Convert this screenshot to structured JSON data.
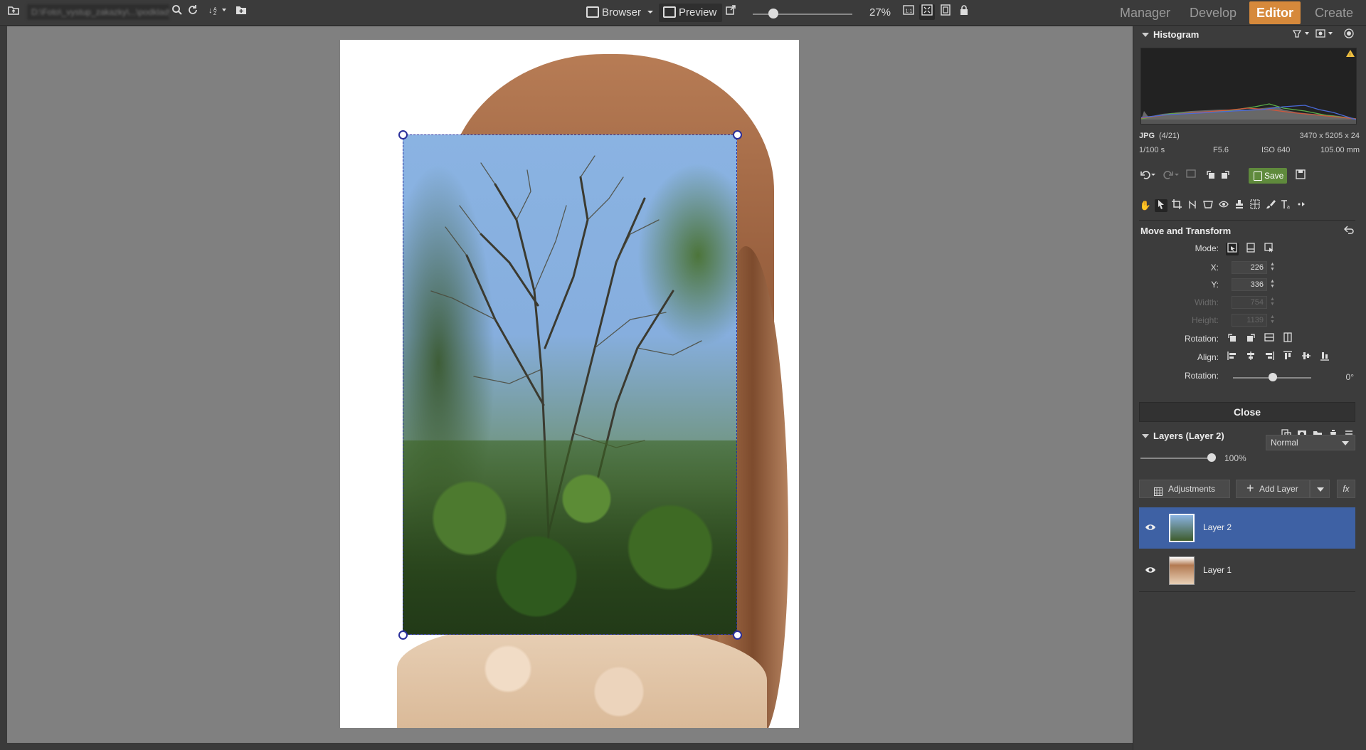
{
  "topbar": {
    "path_text": "D:\\Foto\\_vystup_zakazky\\...\\podklady",
    "browser_label": "Browser",
    "preview_label": "Preview",
    "zoom_value": "27%",
    "zoom_level": 0.27,
    "tabs": [
      {
        "label": "Manager",
        "active": false
      },
      {
        "label": "Develop",
        "active": false
      },
      {
        "label": "Editor",
        "active": true
      },
      {
        "label": "Create",
        "active": false
      }
    ],
    "accent_color": "#d6893b"
  },
  "histogram": {
    "title": "Histogram",
    "format": "JPG",
    "index": "(4/21)",
    "dimensions": "3470 x 5205 x 24",
    "shutter": "1/100 s",
    "aperture": "F5.6",
    "iso": "ISO 640",
    "focal": "105.00 mm"
  },
  "actions": {
    "save_label": "Save"
  },
  "transform": {
    "title": "Move and Transform",
    "mode_label": "Mode:",
    "x_label": "X:",
    "x_value": "226",
    "y_label": "Y:",
    "y_value": "336",
    "width_label": "Width:",
    "width_value": "754",
    "height_label": "Height:",
    "height_value": "1139",
    "rotation_label": "Rotation:",
    "align_label": "Align:",
    "rotation2_label": "Rotation:",
    "rotation_value": "0°",
    "close_label": "Close"
  },
  "layers": {
    "title": "Layers (Layer 2)",
    "opacity": "100%",
    "opacity_level": 1.0,
    "blend_mode": "Normal",
    "adjustments_label": "Adjustments",
    "add_layer_label": "Add Layer",
    "fx_label": "fx",
    "items": [
      {
        "name": "Layer 2",
        "active": true
      },
      {
        "name": "Layer 1",
        "active": false
      }
    ],
    "active_color": "#3e61a4"
  }
}
